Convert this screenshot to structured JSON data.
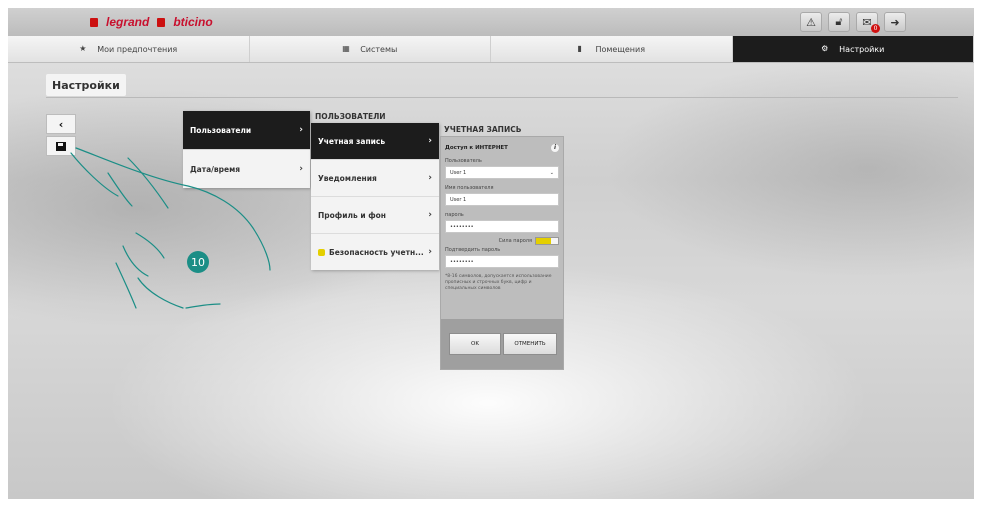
{
  "topbar": {
    "logo_legrand": "legrand",
    "logo_bticino": "bticino",
    "icons": [
      "warning-icon",
      "lock-icon",
      "mail-icon",
      "logout-icon"
    ],
    "mail_badge": "0"
  },
  "tabs": [
    {
      "label": "Мои предпочтения",
      "icon": "star-icon"
    },
    {
      "label": "Системы",
      "icon": "systems-icon"
    },
    {
      "label": "Помещения",
      "icon": "rooms-icon"
    },
    {
      "label": "Настройки",
      "icon": "settings-icon",
      "active": true
    }
  ],
  "page": {
    "title": "Настройки"
  },
  "side_buttons": {
    "back": "‹",
    "save_icon": "save-icon"
  },
  "menu1": {
    "items": [
      {
        "label": "Пользователи",
        "active": true
      },
      {
        "label": "Дата/время"
      }
    ]
  },
  "menu2": {
    "header": "ПОЛЬЗОВАТЕЛИ",
    "items": [
      {
        "label": "Учетная запись",
        "active": true
      },
      {
        "label": "Уведомления"
      },
      {
        "label": "Профиль и фон"
      },
      {
        "label": "Безопасность учетн..."
      }
    ]
  },
  "account": {
    "header": "УЧЕТНАЯ ЗАПИСЬ",
    "section": "Доступ к ИНТЕРНЕТ",
    "user_label": "Пользователь",
    "user_value": "User 1",
    "username_label": "Имя пользователя",
    "username_value": "User 1",
    "password_label": "пароль",
    "password_value": "••••••••",
    "strength_label": "Сила пароля",
    "confirm_label": "Подтвердить пароль",
    "confirm_value": "••••••••",
    "note": "*8-16 символов, допускается использование прописных и строчных букв, цифр и специальных символов",
    "ok": "OK",
    "cancel": "ОТМЕНИТЬ"
  },
  "annotation": {
    "step": "10"
  },
  "colors": {
    "accent_dark": "#1c1c1c",
    "step_badge": "#1b8e86",
    "strength": "#e4cf00",
    "brand_red": "#c8102e"
  }
}
